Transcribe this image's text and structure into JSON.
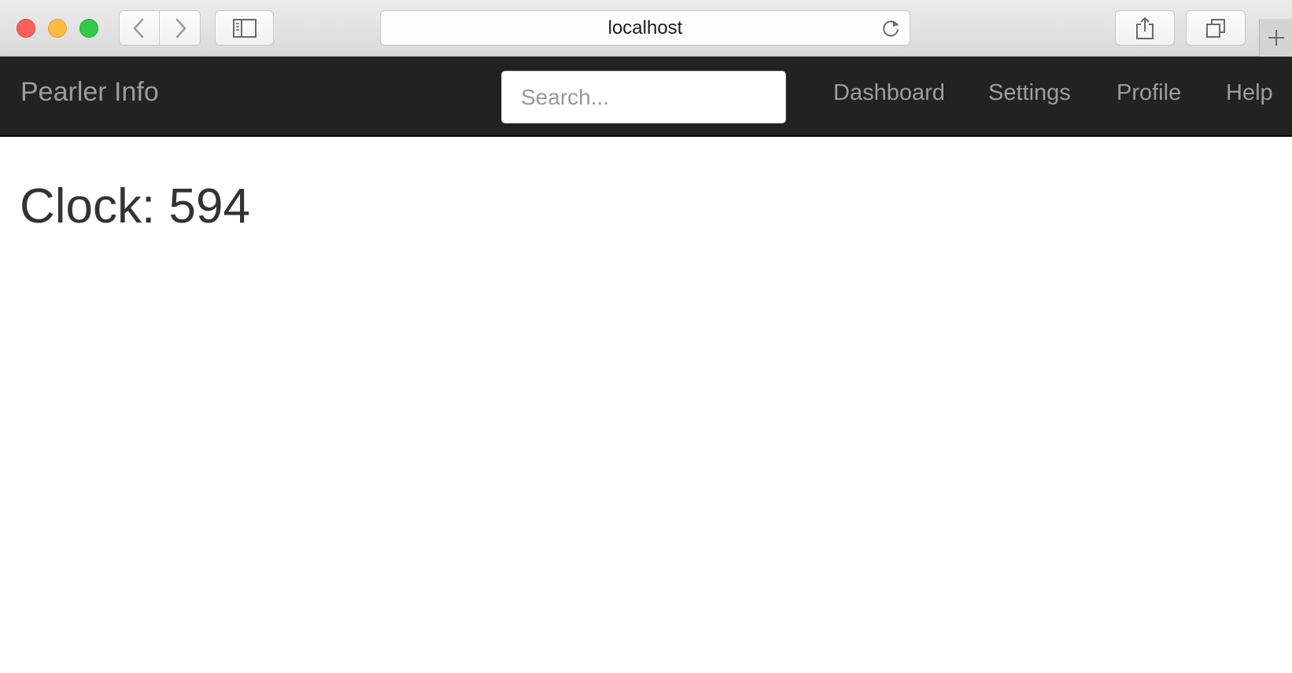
{
  "browser": {
    "url": "localhost",
    "icons": {
      "close": "close-traffic-light",
      "minimize": "minimize-traffic-light",
      "maximize": "maximize-traffic-light",
      "back": "chevron-left-icon",
      "forward": "chevron-right-icon",
      "sidebar": "sidebar-icon",
      "reload": "reload-icon",
      "share": "share-icon",
      "tabs": "tabs-icon",
      "new_tab": "plus-icon"
    }
  },
  "navbar": {
    "brand": "Pearler Info",
    "search_placeholder": "Search...",
    "links": [
      "Dashboard",
      "Settings",
      "Profile",
      "Help"
    ]
  },
  "main": {
    "heading": "Clock: 594"
  },
  "colors": {
    "navbar_bg": "#222222",
    "nav_text": "#9d9d9d",
    "heading_text": "#333333"
  }
}
